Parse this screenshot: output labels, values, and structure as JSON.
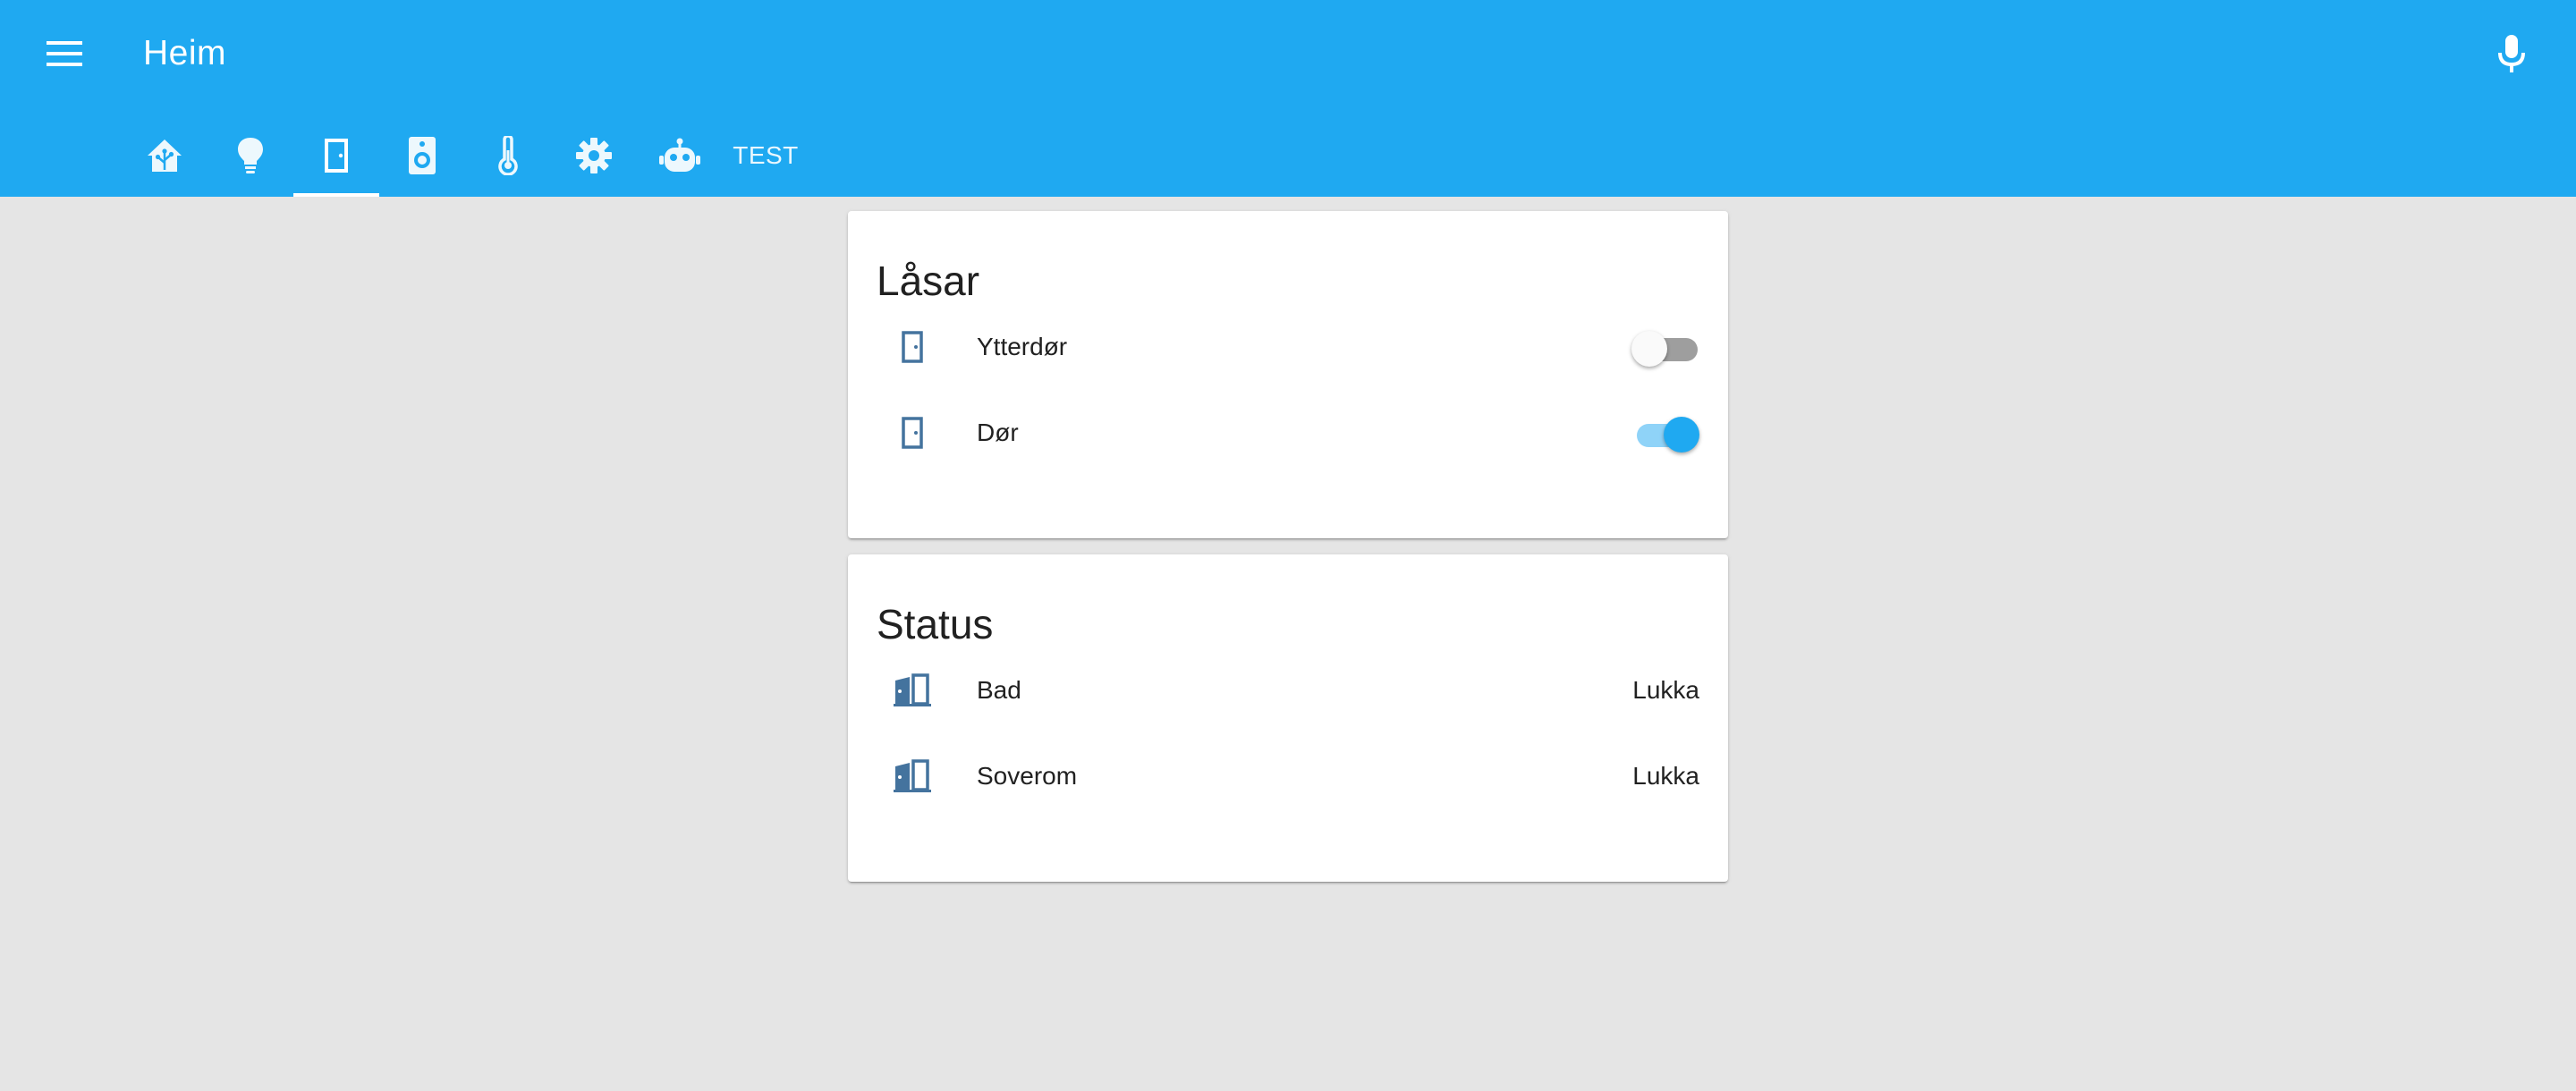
{
  "header": {
    "title": "Heim",
    "menu_icon": "menu-icon",
    "mic_icon": "microphone-icon",
    "background": "#1fa9f1"
  },
  "tabs": [
    {
      "icon": "home-assistant-icon",
      "active": false
    },
    {
      "icon": "lightbulb-icon",
      "active": false
    },
    {
      "icon": "door-icon",
      "active": true
    },
    {
      "icon": "speaker-icon",
      "active": false
    },
    {
      "icon": "thermometer-icon",
      "active": false
    },
    {
      "icon": "gear-icon",
      "active": false
    },
    {
      "icon": "robot-icon",
      "active": false
    },
    {
      "label": "TEST",
      "active": false
    }
  ],
  "cards": {
    "locks": {
      "title": "Låsar",
      "items": [
        {
          "label": "Ytterdør",
          "icon": "door-icon",
          "state": "off"
        },
        {
          "label": "Dør",
          "icon": "door-icon",
          "state": "on"
        }
      ]
    },
    "status": {
      "title": "Status",
      "items": [
        {
          "label": "Bad",
          "icon": "door-closed-icon",
          "value": "Lukka"
        },
        {
          "label": "Soverom",
          "icon": "door-closed-icon",
          "value": "Lukka"
        }
      ]
    }
  },
  "colors": {
    "accent": "#1fa9f1",
    "icon": "#44739e",
    "background": "#e5e5e5"
  }
}
